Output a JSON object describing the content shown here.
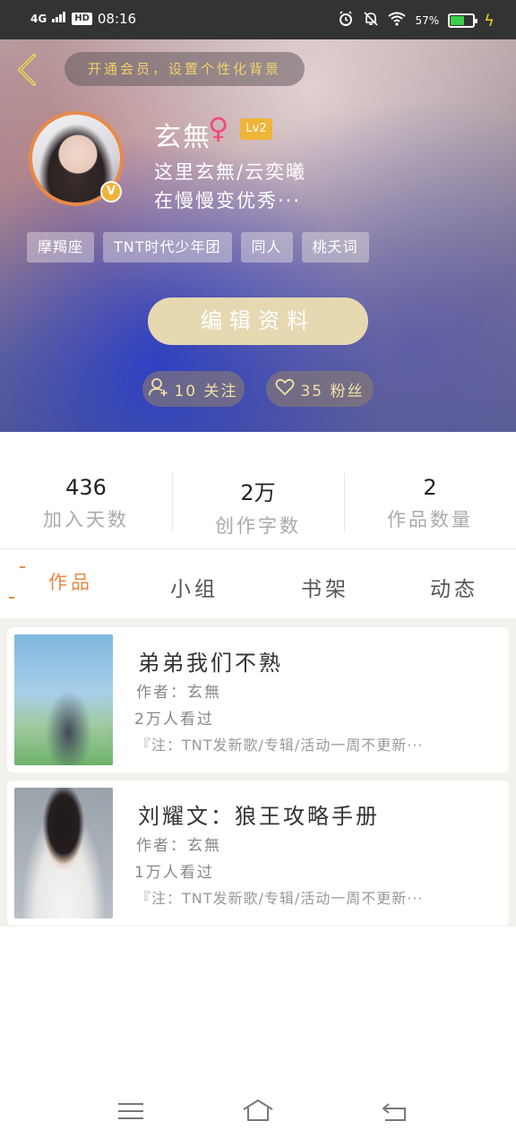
{
  "status_bar": {
    "network": "4G",
    "hd": "HD",
    "time": "08:16",
    "battery": "57%"
  },
  "header": {
    "vip_banner": "开通会员，设置个性化背景",
    "username": "玄無",
    "gender_symbol": "♀",
    "level": "Lv2",
    "verified_badge": "V",
    "bio_line1": "这里玄無/云奕曦",
    "bio_line2": "在慢慢变优秀···",
    "tags": [
      "摩羯座",
      "TNT时代少年团",
      "同人",
      "桃夭词"
    ],
    "edit_button": "编辑资料",
    "following": "10 关注",
    "fans": "35 粉丝"
  },
  "stats": [
    {
      "value": "436",
      "label": "加入天数"
    },
    {
      "value": "2万",
      "label": "创作字数"
    },
    {
      "value": "2",
      "label": "作品数量"
    }
  ],
  "tabs": [
    {
      "label": "作品",
      "active": true
    },
    {
      "label": "小组",
      "active": false
    },
    {
      "label": "书架",
      "active": false
    },
    {
      "label": "动态",
      "active": false
    }
  ],
  "works": [
    {
      "title": "弟弟我们不熟",
      "author": "作者：玄無",
      "views": "2万人看过",
      "desc": "『注：TNT发新歌/专辑/活动一周不更新···"
    },
    {
      "title": "刘耀文：狼王攻略手册",
      "author": "作者：玄無",
      "views": "1万人看过",
      "desc": "『注：TNT发新歌/专辑/活动一周不更新···"
    }
  ],
  "colors": {
    "accent": "#e9893e",
    "vip_text": "#f1d36b",
    "level_badge": "#f0b43a",
    "edit_button_bg": "#e6d9b2",
    "gender": "#ef4c7a"
  },
  "icons": {
    "back": "chevron-left-icon",
    "follow": "add-user-icon",
    "fans": "heart-icon",
    "nav_menu": "menu-icon",
    "nav_home": "home-icon",
    "nav_back": "return-icon"
  }
}
